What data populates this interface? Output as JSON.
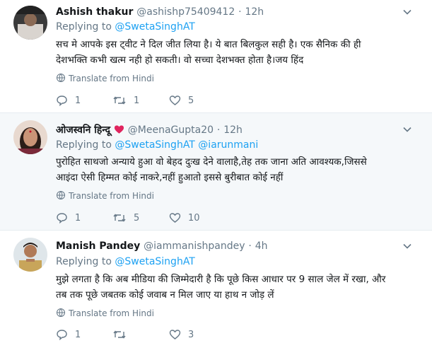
{
  "tweets": [
    {
      "name": "Ashish thakur",
      "handle": "@ashishp75409412",
      "time": "12h",
      "replying_label": "Replying to",
      "mentions": "@SwetaSinghAT",
      "text_line1": "सच मे आपके इस ट्वीट ने दिल जीत लिया है। ये बात बिलकुल सही है। एक सैनिक की ही",
      "text_line2": "देशभक्ति कभी खत्म नही हो सकती। वो सच्चा देशभक्त होता है।जय हिंद",
      "translate": "Translate from Hindi",
      "replies": "1",
      "retweets": "1",
      "likes": "5"
    },
    {
      "name": "ओजस्वनि हिन्दू",
      "handle": "@MeenaGupta20",
      "time": "12h",
      "replying_label": "Replying to",
      "mentions": "@SwetaSinghAT @iarunmani",
      "text_line1": "पुरोहित साथजो अन्याये हुआ वो बेहद दुःख देने वालाहै,तेह तक जाना अति आवश्यक,जिससे",
      "text_line2": "आइंदा ऐसी हिम्मत कोई नाकरे,नहीं हुआतो इससे बुरीबात कोई नहीं",
      "translate": "Translate from Hindi",
      "replies": "1",
      "retweets": "5",
      "likes": "10"
    },
    {
      "name": "Manish Pandey",
      "handle": "@iammanishpandey",
      "time": "4h",
      "replying_label": "Replying to",
      "mentions": "@SwetaSinghAT",
      "text_line1": "मुझे लगता है कि अब मीडिया की जिम्मेदारी है कि पूछे किस आधार पर 9 साल जेल में रखा, और",
      "text_line2": "तब तक पूछे जबतक कोई जवाब न मिल जाए या हाथ न जोड़ लें",
      "translate": "Translate from Hindi",
      "replies": "1",
      "retweets": "",
      "likes": "3"
    }
  ],
  "colors": {
    "link": "#1da1f2",
    "muted": "#657786",
    "heart": "#e0245e",
    "highlight_bg": "#f5f8fa"
  }
}
